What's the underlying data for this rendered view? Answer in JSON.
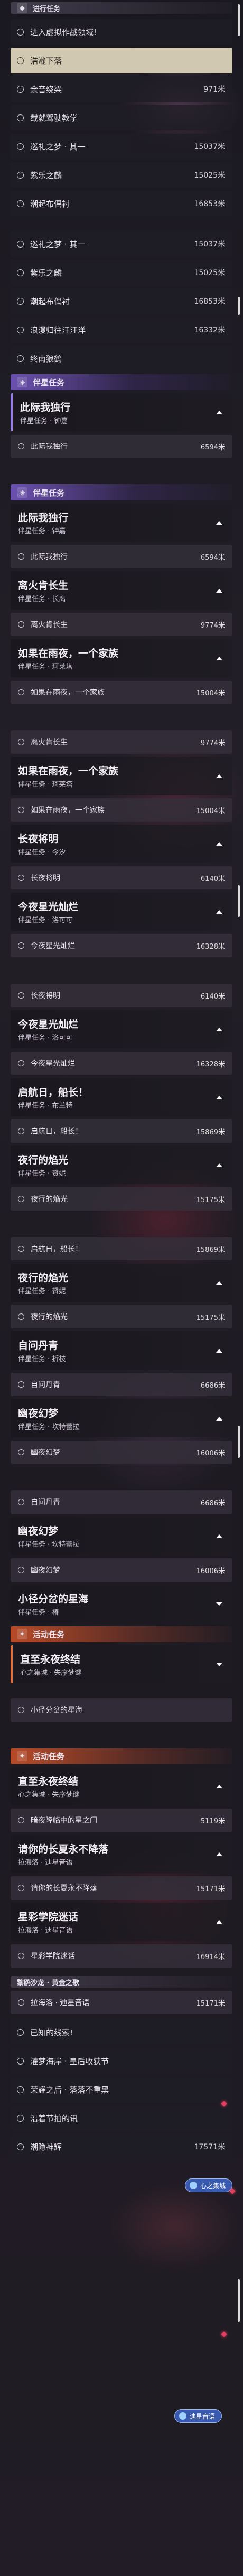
{
  "sec1": {
    "title": "进行任务",
    "items": [
      {
        "label": "进入虚拟作战领域!",
        "dist": ""
      },
      {
        "label": "浩瀚下落",
        "dist": "",
        "selected": true
      },
      {
        "label": "余音绕梁",
        "dist": "971米"
      },
      {
        "label": "载就驾驶教学",
        "dist": ""
      },
      {
        "label": "巡礼之梦 · 其一",
        "dist": "15037米"
      },
      {
        "label": "紫乐之麟",
        "dist": "15025米"
      },
      {
        "label": "潮起布偶衬",
        "dist": "16853米"
      }
    ],
    "items2": [
      {
        "label": "巡礼之梦 · 其一",
        "dist": "15037米"
      },
      {
        "label": "紫乐之麟",
        "dist": "15025米"
      },
      {
        "label": "潮起布偶衬",
        "dist": "16853米"
      },
      {
        "label": "浪漫归往汪汪洋",
        "dist": "16332米"
      },
      {
        "label": "终南狼鹤",
        "dist": ""
      }
    ]
  },
  "side1": {
    "title": "伴星任务",
    "card": {
      "title": "此际我独行",
      "sub": "伴星任务 · 钟嘉"
    },
    "sub": {
      "label": "此际我独行",
      "dist": "6594米"
    }
  },
  "side2": {
    "title": "伴星任务",
    "c1": {
      "title": "此际我独行",
      "sub": "伴星任务 · 钟嘉",
      "sub_label": "此际我独行",
      "dist": "6594米"
    },
    "c2": {
      "title": "离火肯长生",
      "sub": "伴星任务 · 长离",
      "sub_label": "离火肯长生",
      "dist": "9774米"
    },
    "c3": {
      "title": "如果在雨夜，一个家族",
      "sub": "伴星任务 · 珂莱塔",
      "sub_label": "如果在雨夜，一个家族",
      "dist": "15004米"
    },
    "c3b": {
      "sub_label": "离火肯长生",
      "dist": "9774米"
    },
    "c4": {
      "title": "如果在雨夜，一个家族",
      "sub": "伴星任务 · 珂莱塔",
      "sub_label": "如果在雨夜，一个家族",
      "dist": "15004米"
    },
    "c5": {
      "title": "长夜将明",
      "sub": "伴星任务 · 今汐",
      "sub_label": "长夜将明",
      "dist": "6140米"
    },
    "c6": {
      "title": "今夜星光灿烂",
      "sub": "伴星任务 · 洛可可",
      "sub_label": "今夜星光灿烂",
      "dist": "16328米"
    },
    "c6b": {
      "sub_label": "长夜将明",
      "dist": "6140米"
    },
    "c7": {
      "title": "今夜星光灿烂",
      "sub": "伴星任务 · 洛可可",
      "sub_label": "今夜星光灿烂",
      "dist": "16328米"
    },
    "c8": {
      "title": "启航日，船长！",
      "sub": "伴星任务 · 布兰特",
      "sub_label": "启航日，船长！",
      "dist": "15869米"
    },
    "c9": {
      "title": "夜行的焰光",
      "sub": "伴星任务 · 赞妮",
      "sub_label": "夜行的焰光",
      "dist": "15175米"
    },
    "c9b": {
      "sub_label": "启航日，船长！",
      "dist": "15869米"
    },
    "c10": {
      "title": "夜行的焰光",
      "sub": "伴星任务 · 赞妮",
      "sub_label": "夜行的焰光",
      "dist": "15175米"
    },
    "c11": {
      "title": "自问丹青",
      "sub": "伴星任务 · 折枝",
      "sub_label": "自问丹青",
      "dist": "6686米"
    },
    "c12": {
      "title": "幽夜幻梦",
      "sub": "伴星任务 · 坎特蕾拉",
      "sub_label": "幽夜幻梦",
      "dist": "16006米"
    },
    "c12b": {
      "sub_label": "自问丹青",
      "dist": "6686米"
    },
    "c13": {
      "title": "幽夜幻梦",
      "sub": "伴星任务 · 坎特蕾拉",
      "sub_label": "幽夜幻梦",
      "dist": "16006米"
    },
    "c14": {
      "title": "小径分岔的星海",
      "sub": "伴星任务 · 椿",
      "sub_label": "",
      "dist": ""
    }
  },
  "event1": {
    "title": "活动任务",
    "c1": {
      "title": "直至永夜终结",
      "sub": "心之集城 · 失序梦谜"
    },
    "after": {
      "label": "小径分岔的星海",
      "dist": ""
    }
  },
  "event2": {
    "title": "活动任务",
    "c1": {
      "title": "直至永夜终结",
      "sub": "心之集城 · 失序梦谜",
      "sub_label": "暗夜降临中的星之门",
      "dist": "5119米"
    },
    "c2": {
      "title": "请你的长夏永不降落",
      "sub": "拉海洛 · 迪星音语",
      "sub_label": "请你的长夏永不降落",
      "dist": "15171米"
    },
    "c3": {
      "title": "星彩学院迷话",
      "sub": "拉海洛 · 迪星音语",
      "sub_label": "星彩学院迷话",
      "dist": "16914米"
    },
    "c3b": {
      "label": "黎鸥沙龙 · 黄金之歌",
      "dist": ""
    },
    "c3c": {
      "label": "拉海洛 · 迪星音语",
      "dist": "15171米"
    }
  },
  "tail": {
    "items": [
      {
        "label": "已知的线索!",
        "dist": ""
      },
      {
        "label": "灌梦海岸 · 皇后收获节",
        "dist": ""
      },
      {
        "label": "荣耀之后 · 落落不重黑",
        "dist": ""
      },
      {
        "label": "沿着节拍的讯",
        "dist": ""
      },
      {
        "label": "潮隐神辉",
        "dist": "17571米"
      }
    ]
  },
  "toasts": {
    "heart_city": "心之集城",
    "rhythm": "迪星音语"
  },
  "icons": {
    "task": "task-icon",
    "side": "companion-icon",
    "event": "event-icon"
  }
}
